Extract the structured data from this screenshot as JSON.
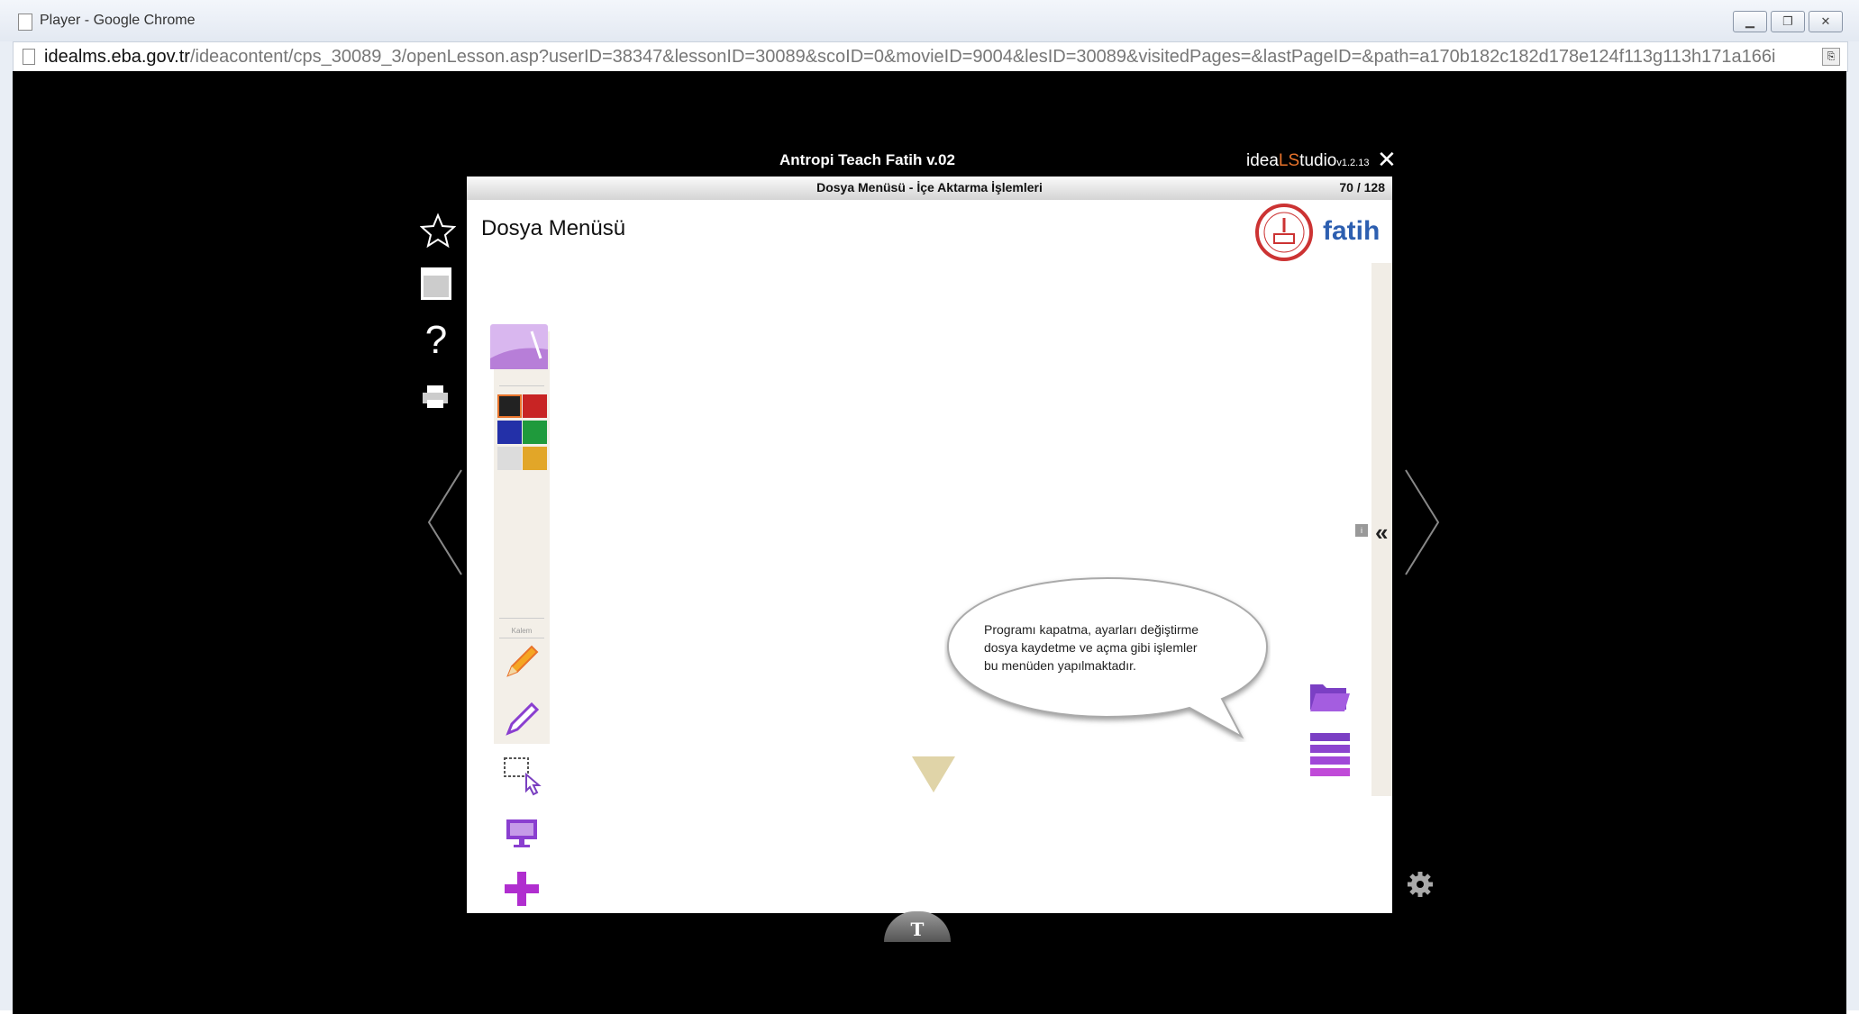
{
  "window": {
    "title": "Player - Google Chrome"
  },
  "url": {
    "host": "idealms.eba.gov.tr",
    "path": "/ideacontent/cps_30089_3/openLesson.asp?userID=38347&lessonID=30089&scoID=0&movieID=9004&lesID=30089&visitedPages=&lastPageID=&path=a170b182c182d178e124f113g113h171a166i"
  },
  "app": {
    "title": "Antropi Teach Fatih v.02",
    "studio_prefix": "idea",
    "studio_accent": "LS",
    "studio_suffix": "tudio",
    "studio_version": "v1.2.13"
  },
  "lesson": {
    "section_title": "Dosya Menüsü - İçe Aktarma İşlemleri",
    "page_indicator": "70 / 128",
    "heading": "Dosya Menüsü",
    "logo_text": "fatih"
  },
  "toolbar": {
    "pen_label": "Kalem"
  },
  "bubble": {
    "line1": "Programı kapatma, ayarları değiştirme",
    "line2": "dosya kaydetme ve açma gibi işlemler",
    "line3": "bu menüden yapılmaktadır."
  },
  "bottom_tab": {
    "label": "T"
  },
  "colors": {
    "accent": "#e8732b",
    "purple": "#8a3fd0",
    "fatih_blue": "#2d5fb0",
    "stage": "#000000"
  }
}
